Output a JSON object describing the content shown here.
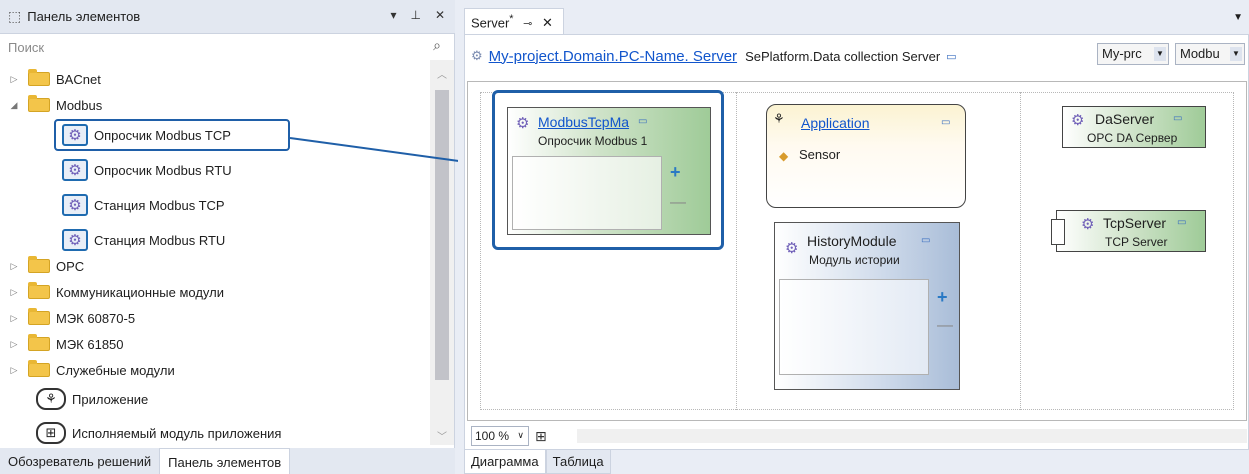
{
  "toolbox": {
    "title": "Панель элементов",
    "search_placeholder": "Поиск",
    "controls": [
      "▾",
      "⊥",
      "✕"
    ],
    "items": [
      {
        "label": "BACnet"
      },
      {
        "label": "Modbus"
      },
      {
        "label": "Опросчик Modbus TCP"
      },
      {
        "label": "Опросчик Modbus RTU"
      },
      {
        "label": "Станция Modbus TCP"
      },
      {
        "label": "Станция Modbus RTU"
      },
      {
        "label": "OPC"
      },
      {
        "label": "Коммуникационные модули"
      },
      {
        "label": "МЭК 60870-5"
      },
      {
        "label": "МЭК 61850"
      },
      {
        "label": "Служебные модули"
      },
      {
        "label": "Приложение"
      },
      {
        "label": "Исполняемый модуль приложения"
      }
    ],
    "bottom_tabs": [
      "Обозреватель решений",
      "Панель элементов"
    ]
  },
  "editor": {
    "doc_tab": "Server",
    "doc_tab_modified": "*",
    "breadcrumb_link": "My-project.Domain.PC-Name. Server",
    "platform": "SePlatform.Data collection Server",
    "select1": "My-prc",
    "select2": "Modbu",
    "zoom": "100 %",
    "bottom_tabs": [
      "Диаграмма",
      "Таблица"
    ]
  },
  "diagram": {
    "modbus": {
      "title": "ModbusTcpMa",
      "sub": "Опросчик Modbus 1"
    },
    "application": {
      "title": "Application",
      "item": "Sensor"
    },
    "history": {
      "title": "HistoryModule",
      "sub": "Модуль истории"
    },
    "daserver": {
      "title": "DaServer",
      "sub": "OPC DA Сервер"
    },
    "tcpserver": {
      "title": "TcpServer",
      "sub": "TCP Server"
    }
  },
  "colors": {
    "accent": "#1f5fa8",
    "green_node": "#9fcb98",
    "blue_node": "#a9bdd8",
    "yellow_node": "#fbf3d2"
  }
}
